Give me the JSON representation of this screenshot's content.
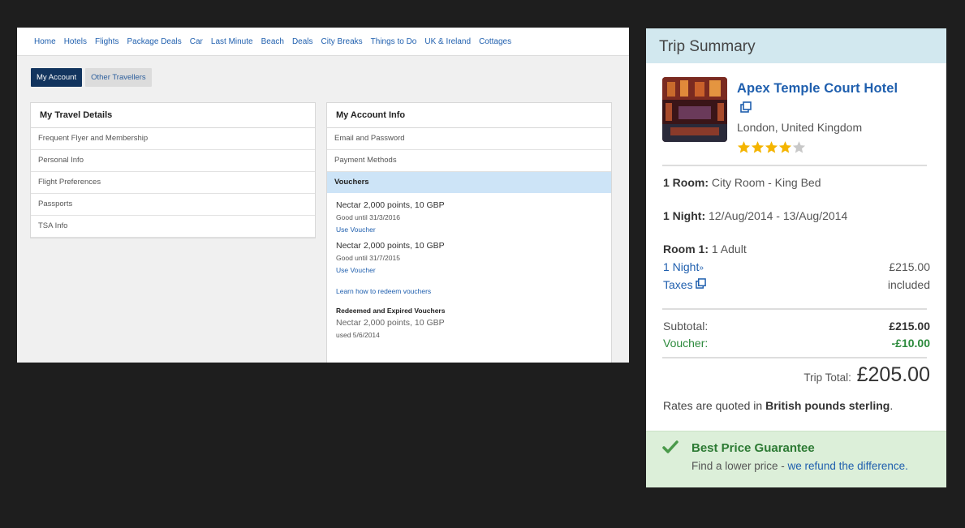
{
  "nav": {
    "links": [
      "Home",
      "Hotels",
      "Flights",
      "Package Deals",
      "Car",
      "Last Minute",
      "Beach",
      "Deals",
      "City Breaks",
      "Things to Do",
      "UK & Ireland",
      "Cottages"
    ]
  },
  "account_tabs": {
    "my_account": "My Account",
    "other_travellers": "Other Travellers"
  },
  "travel_details": {
    "title": "My Travel Details",
    "items": [
      "Frequent Flyer and Membership",
      "Personal Info",
      "Flight Preferences",
      "Passports",
      "TSA Info"
    ]
  },
  "account_info": {
    "title": "My Account Info",
    "items": [
      "Email and Password",
      "Payment Methods"
    ],
    "vouchers_label": "Vouchers",
    "vouchers": [
      {
        "title": "Nectar 2,000 points, 10 GBP",
        "validity": "Good until 31/3/2016",
        "action": "Use Voucher"
      },
      {
        "title": "Nectar 2,000 points, 10 GBP",
        "validity": "Good until 31/7/2015",
        "action": "Use Voucher"
      }
    ],
    "learn_link": "Learn how to redeem vouchers",
    "redeemed_heading": "Redeemed and Expired Vouchers",
    "redeemed": {
      "title": "Nectar 2,000 points, 10 GBP",
      "used": "used 5/6/2014"
    }
  },
  "trip_summary": {
    "header": "Trip Summary",
    "hotel_name": "Apex Temple Court Hotel",
    "hotel_location": "London, United Kingdom",
    "star_rating": 4,
    "star_max": 5,
    "room_label": "1 Room:",
    "room_value": "City Room - King Bed",
    "night_label": "1 Night:",
    "night_value": "12/Aug/2014 - 13/Aug/2014",
    "room1_label": "Room 1:",
    "room1_value": "1 Adult",
    "night_link": "1 Night",
    "night_price": "£215.00",
    "taxes_link": "Taxes",
    "taxes_value": "included",
    "subtotal_label": "Subtotal:",
    "subtotal_value": "£215.00",
    "voucher_label": "Voucher:",
    "voucher_value": "-£10.00",
    "total_label": "Trip Total:",
    "total_value": "£205.00",
    "rates_prefix": "Rates are quoted in ",
    "rates_bold": "British pounds sterling",
    "rates_suffix": ".",
    "guarantee_title": "Best Price Guarantee",
    "guarantee_text": "Find a lower price - ",
    "guarantee_link": "we refund the difference."
  },
  "colors": {
    "link_blue": "#1f5fae",
    "tab_active": "#12345e",
    "header_bg": "#d2e8ef",
    "star": "#f4b400",
    "green": "#2c8a3c",
    "guarantee_bg": "#dcefd9"
  }
}
